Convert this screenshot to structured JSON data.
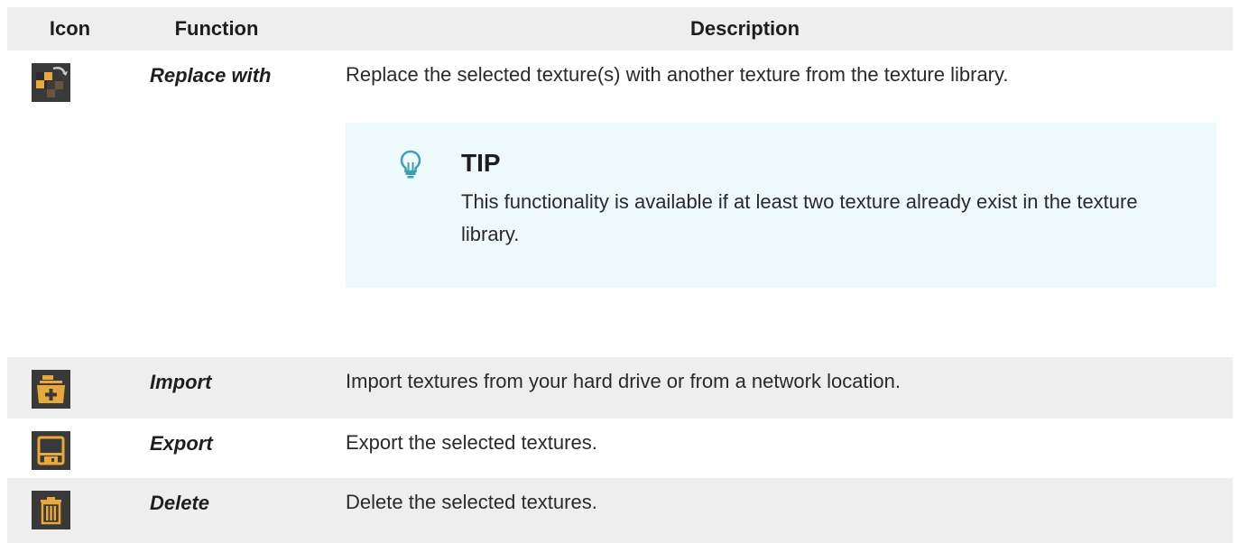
{
  "table": {
    "headers": {
      "icon": "Icon",
      "function": "Function",
      "description": "Description"
    },
    "rows": [
      {
        "icon": "replace-texture-icon",
        "function": "Replace with",
        "description": "Replace the selected texture(s) with another texture from the texture library.",
        "tip": {
          "icon": "lightbulb-icon",
          "title": "TIP",
          "text": "This functionality is available if at least two texture already exist in the texture library."
        }
      },
      {
        "icon": "import-folder-icon",
        "function": "Import",
        "description": "Import textures from your hard drive or from a network location."
      },
      {
        "icon": "export-save-icon",
        "function": "Export",
        "description": "Export the selected textures."
      },
      {
        "icon": "delete-trash-icon",
        "function": "Delete",
        "description": "Delete the selected textures."
      }
    ]
  },
  "colors": {
    "header_bg": "#eeeeee",
    "stripe_bg": "#eeeeee",
    "tip_bg": "#eef9fb",
    "tip_accent": "#3a9fb5",
    "icon_bg": "#393939",
    "icon_orange": "#e7a93b"
  }
}
